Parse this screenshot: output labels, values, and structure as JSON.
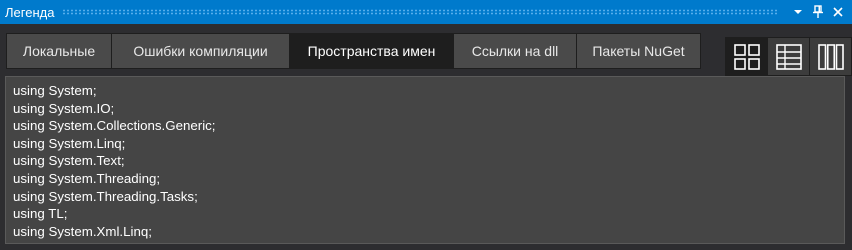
{
  "window": {
    "title": "Легенда"
  },
  "titlebar_buttons": {
    "menu_icon": "chevron-down-icon",
    "pin_icon": "pin-icon",
    "close_icon": "close-icon"
  },
  "tabs": [
    {
      "label": "Локальные",
      "active": false
    },
    {
      "label": "Ошибки компиляции",
      "active": false
    },
    {
      "label": "Пространства имен",
      "active": true
    },
    {
      "label": "Ссылки на dll",
      "active": false
    },
    {
      "label": "Пакеты NuGet",
      "active": false
    }
  ],
  "view_modes": [
    {
      "icon": "tiles-view-icon",
      "active": true
    },
    {
      "icon": "table-view-icon",
      "active": false
    },
    {
      "icon": "columns-view-icon",
      "active": false
    }
  ],
  "content": {
    "lines": [
      "using System;",
      "using System.IO;",
      "using System.Collections.Generic;",
      "using System.Linq;",
      "using System.Text;",
      "using System.Threading;",
      "using System.Threading.Tasks;",
      "using TL;",
      "using System.Xml.Linq;"
    ]
  },
  "colors": {
    "titlebar": "#007acc",
    "background": "#2d2d30",
    "tab_active": "#1e1e1e",
    "tab_inactive": "#4a4a4a",
    "content_bg": "#454545"
  }
}
